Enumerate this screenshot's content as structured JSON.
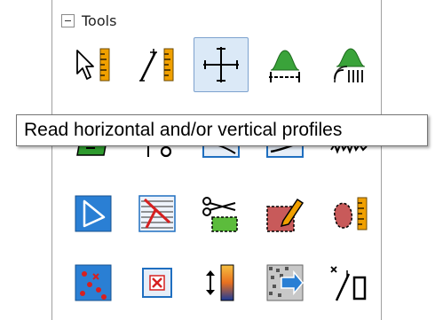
{
  "panel": {
    "title": "Tools"
  },
  "tooltip": {
    "text": "Read horizontal and/or vertical profiles"
  },
  "tools": [
    {
      "icon": "pointer-ruler-icon",
      "selected": false
    },
    {
      "icon": "line-ruler-icon",
      "selected": false
    },
    {
      "icon": "crosshair-profile-icon",
      "selected": true
    },
    {
      "icon": "peak-measure-icon",
      "selected": false
    },
    {
      "icon": "peak-signal-icon",
      "selected": false
    },
    {
      "icon": "area-fill-icon",
      "selected": false
    },
    {
      "icon": "probe-icon",
      "selected": false
    },
    {
      "icon": "curve-box-icon",
      "selected": false
    },
    {
      "icon": "curve-box-dark-icon",
      "selected": false
    },
    {
      "icon": "noise-wave-icon",
      "selected": false
    },
    {
      "icon": "triangle-select-icon",
      "selected": false
    },
    {
      "icon": "line-hatch-icon",
      "selected": false
    },
    {
      "icon": "scissors-cut-icon",
      "selected": false
    },
    {
      "icon": "pencil-region-icon",
      "selected": false
    },
    {
      "icon": "blob-ruler-icon",
      "selected": false
    },
    {
      "icon": "scatter-points-icon",
      "selected": false
    },
    {
      "icon": "delete-box-icon",
      "selected": false
    },
    {
      "icon": "color-scale-icon",
      "selected": false
    },
    {
      "icon": "image-export-icon",
      "selected": false
    },
    {
      "icon": "point-ruler-icon",
      "selected": false
    }
  ],
  "colors": {
    "accent_blue": "#1f6fc0",
    "ruler_orange": "#f0a000",
    "green": "#2f9b2f",
    "red": "#d62020",
    "selected_bg": "#dbe9f7"
  }
}
